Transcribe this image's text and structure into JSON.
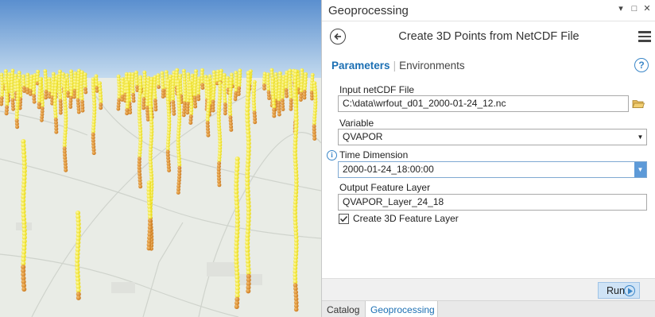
{
  "pane": {
    "title": "Geoprocessing",
    "controls": {
      "pin": "▾",
      "maximize": "□",
      "close": "✕"
    },
    "tool_title": "Create 3D Points from NetCDF File",
    "tabs": {
      "parameters": "Parameters",
      "separator": "|",
      "environments": "Environments"
    },
    "help_glyph": "?",
    "params": [
      {
        "label": "Input netCDF File",
        "value": "C:\\data\\wrfout_d01_2000-01-24_12.nc",
        "control": "file"
      },
      {
        "label": "Variable",
        "value": "QVAPOR",
        "control": "dropdown"
      },
      {
        "label": "Time Dimension",
        "value": "2000-01-24_18:00:00",
        "control": "dropdown-active"
      },
      {
        "label": "Output Feature Layer",
        "value": "QVAPOR_Layer_24_18",
        "control": "text"
      }
    ],
    "info_glyph": "i",
    "checkbox": {
      "label": "Create 3D Feature Layer",
      "checked": true
    },
    "run_label": "Run",
    "bottom_tabs": {
      "catalog": "Catalog",
      "geoprocessing": "Geoprocessing"
    }
  },
  "scene": {
    "sky_top": "#5a8fcf",
    "sky_bottom": "#c6dcef",
    "ground": "#e9ece6",
    "point_yellow": "#f2e400",
    "point_orange": "#d98a1e"
  },
  "colors": {
    "accent": "#1b6fb3",
    "run_button": "#cfe3f6"
  }
}
